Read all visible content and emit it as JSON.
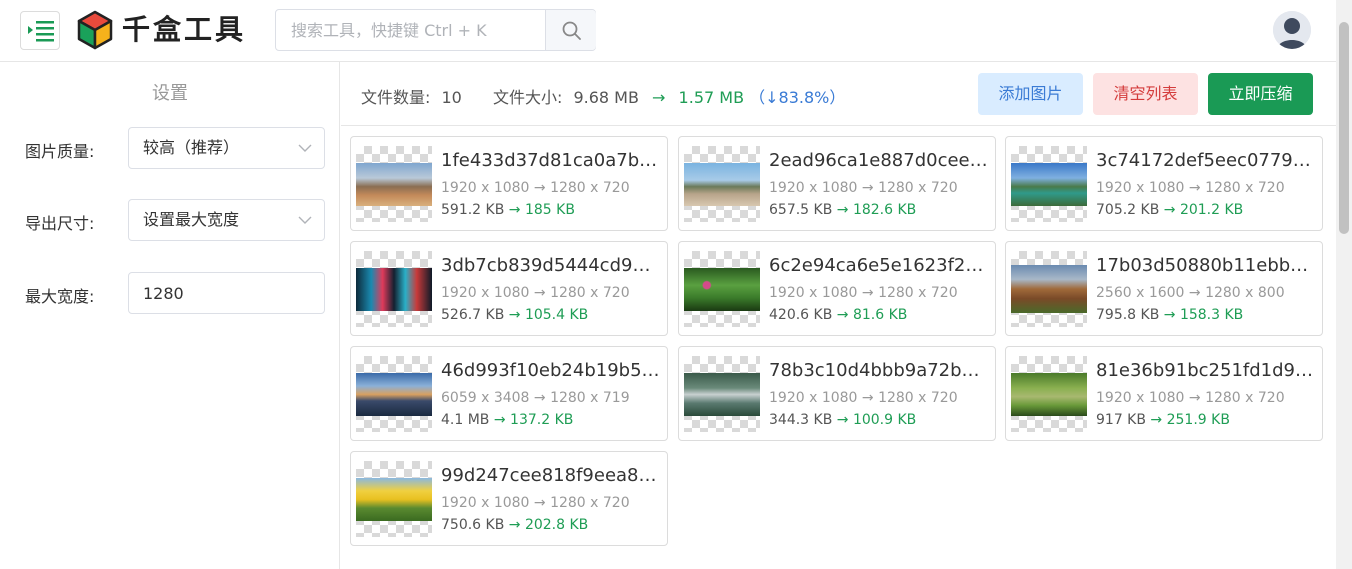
{
  "header": {
    "brand": "千盒工具",
    "search_placeholder": "搜索工具，快捷键 Ctrl + K"
  },
  "sidebar": {
    "title": "设置",
    "quality_label": "图片质量:",
    "quality_value": "较高（推荐）",
    "export_label": "导出尺寸:",
    "export_value": "设置最大宽度",
    "maxwidth_label": "最大宽度:",
    "maxwidth_value": "1280"
  },
  "toolbar": {
    "count_label": "文件数量:",
    "count_value": "10",
    "size_label": "文件大小:",
    "size_before": "9.68 MB",
    "arrow": "→",
    "size_after": "1.57 MB",
    "saving": "（↓83.8%）",
    "add_label": "添加图片",
    "clear_label": "清空列表",
    "compress_label": "立即压缩"
  },
  "files": [
    {
      "name": "1fe433d37d81ca0a7b…",
      "dims": "1920 x 1080 → 1280 x 720",
      "size_before": "591.2 KB",
      "size_after": "→ 185 KB"
    },
    {
      "name": "2ead96ca1e887d0cee…",
      "dims": "1920 x 1080 → 1280 x 720",
      "size_before": "657.5 KB",
      "size_after": "→ 182.6 KB"
    },
    {
      "name": "3c74172def5eec0779…",
      "dims": "1920 x 1080 → 1280 x 720",
      "size_before": "705.2 KB",
      "size_after": "→ 201.2 KB"
    },
    {
      "name": "3db7cb839d5444cd9…",
      "dims": "1920 x 1080 → 1280 x 720",
      "size_before": "526.7 KB",
      "size_after": "→ 105.4 KB"
    },
    {
      "name": "6c2e94ca6e5e1623f2…",
      "dims": "1920 x 1080 → 1280 x 720",
      "size_before": "420.6 KB",
      "size_after": "→ 81.6 KB"
    },
    {
      "name": "17b03d50880b11ebb…",
      "dims": "2560 x 1600 → 1280 x 800",
      "size_before": "795.8 KB",
      "size_after": "→ 158.3 KB"
    },
    {
      "name": "46d993f10eb24b19b5…",
      "dims": "6059 x 3408 → 1280 x 719",
      "size_before": "4.1 MB",
      "size_after": "→ 137.2 KB"
    },
    {
      "name": "78b3c10d4bbb9a72b…",
      "dims": "1920 x 1080 → 1280 x 720",
      "size_before": "344.3 KB",
      "size_after": "→ 100.9 KB"
    },
    {
      "name": "81e36b91bc251fd1d9…",
      "dims": "1920 x 1080 → 1280 x 720",
      "size_before": "917 KB",
      "size_after": "→ 251.9 KB"
    },
    {
      "name": "99d247cee818f9eea8…",
      "dims": "1920 x 1080 → 1280 x 720",
      "size_before": "750.6 KB",
      "size_after": "→ 202.8 KB"
    }
  ]
}
